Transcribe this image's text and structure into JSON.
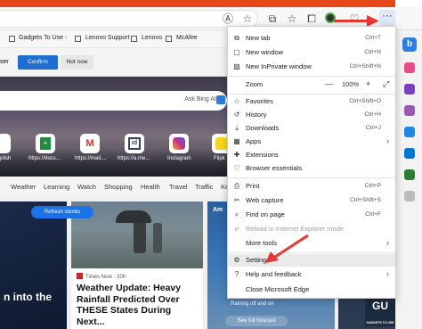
{
  "favorites": [
    {
      "label": "Gadgets To Use -"
    },
    {
      "label": "Lenovo Support"
    },
    {
      "label": "Lenovo"
    },
    {
      "label": "McAfee"
    }
  ],
  "cookie": {
    "left_text": "ser",
    "confirm": "Confirm",
    "not_now": "Not now"
  },
  "search": {
    "placeholder": "Ask Bing AI"
  },
  "tiles": [
    {
      "label": "plish",
      "color": "#1e88e5",
      "glyph": ""
    },
    {
      "label": "https://docs...",
      "color": "#1e8e3e",
      "glyph": "▦"
    },
    {
      "label": "https://mail....",
      "color": "#d93025",
      "glyph": "M"
    },
    {
      "label": "https://a.me...",
      "color": "#37474f",
      "glyph": "▣"
    },
    {
      "label": "Instagram",
      "color": "#c13584",
      "glyph": "◉"
    },
    {
      "label": "Flipk",
      "color": "#f9d71c",
      "glyph": "▼"
    }
  ],
  "categories": [
    "Weather",
    "Learning",
    "Watch",
    "Shopping",
    "Health",
    "Travel",
    "Traffic",
    "Ke"
  ],
  "content": {
    "refresh": "Refresh stories",
    "left_text": "n into the",
    "source": "Times Now · 20h",
    "headline": "Weather Update: Heavy Rainfall Predicted Over THESE States During Next...",
    "right_top": "Am",
    "right_note": "Raining off and on",
    "right_btn": "See full forecast",
    "watermark": "GU",
    "watermark_sub": "GADGETS TO USE"
  },
  "menu": {
    "new_tab": {
      "label": "New tab",
      "shortcut": "Ctrl+T"
    },
    "new_window": {
      "label": "New window",
      "shortcut": "Ctrl+N"
    },
    "inprivate": {
      "label": "New InPrivate window",
      "shortcut": "Ctrl+Shift+N"
    },
    "zoom": {
      "label": "Zoom",
      "minus": "—",
      "value": "100%",
      "plus": "+"
    },
    "favorites": {
      "label": "Favorites",
      "shortcut": "Ctrl+Shift+O"
    },
    "history": {
      "label": "History",
      "shortcut": "Ctrl+H"
    },
    "downloads": {
      "label": "Downloads",
      "shortcut": "Ctrl+J"
    },
    "apps": {
      "label": "Apps"
    },
    "extensions": {
      "label": "Extensions"
    },
    "essentials": {
      "label": "Browser essentials"
    },
    "print": {
      "label": "Print",
      "shortcut": "Ctrl+P"
    },
    "web_capture": {
      "label": "Web capture",
      "shortcut": "Ctrl+Shift+S"
    },
    "find": {
      "label": "Find on page",
      "shortcut": "Ctrl+F"
    },
    "reload_ie": {
      "label": "Reload in Internet Explorer mode"
    },
    "more_tools": {
      "label": "More tools"
    },
    "settings": {
      "label": "Settings"
    },
    "help": {
      "label": "Help and feedback"
    },
    "close": {
      "label": "Close Microsoft Edge"
    }
  },
  "icons": {
    "favorites_add": "star-plus-icon",
    "collections": "collections-icon",
    "profile": "profile-icon",
    "more": "more-icon"
  },
  "colors": {
    "accent": "#e8471b",
    "arrow": "#e53935",
    "confirm": "#1f6fd1"
  }
}
